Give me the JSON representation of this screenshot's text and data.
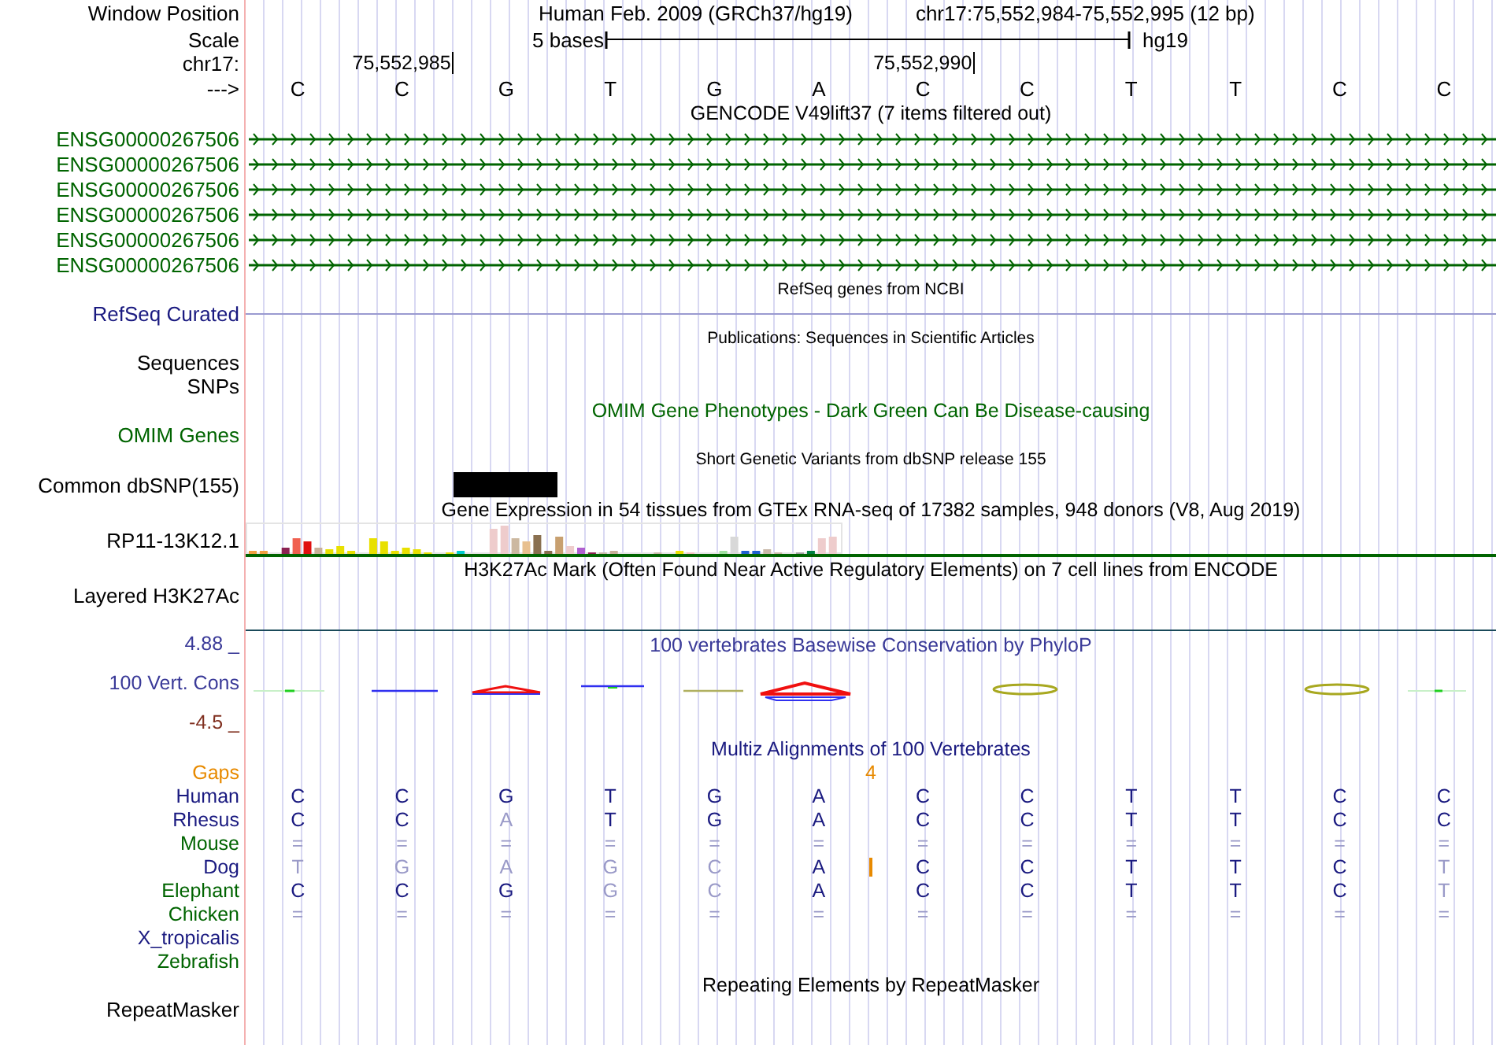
{
  "header": {
    "position_label": "Window Position",
    "assembly": "Human Feb. 2009 (GRCh37/hg19)",
    "position": "chr17:75,552,984-75,552,995 (12 bp)",
    "scale_label": "Scale",
    "scale_text": "5 bases",
    "scale_db": "hg19",
    "chrom_label": "chr17:",
    "ticks": [
      "75,552,985",
      "75,552,990"
    ],
    "strand_label": "--->",
    "bases": [
      "C",
      "C",
      "G",
      "T",
      "G",
      "A",
      "C",
      "C",
      "T",
      "T",
      "C",
      "C"
    ]
  },
  "tracks": [
    {
      "kind": "title",
      "text": "GENCODE V49lift37 (7 items filtered out)",
      "color": "#000000"
    },
    {
      "kind": "gene",
      "label": "ENSG00000267506",
      "color": "#006400"
    },
    {
      "kind": "gene",
      "label": "ENSG00000267506",
      "color": "#006400"
    },
    {
      "kind": "gene",
      "label": "ENSG00000267506",
      "color": "#006400"
    },
    {
      "kind": "gene",
      "label": "ENSG00000267506",
      "color": "#006400"
    },
    {
      "kind": "gene",
      "label": "ENSG00000267506",
      "color": "#006400"
    },
    {
      "kind": "gene",
      "label": "ENSG00000267506",
      "color": "#006400"
    },
    {
      "kind": "note",
      "text": "RefSeq genes from NCBI",
      "color": "#000000"
    },
    {
      "kind": "line",
      "label": "RefSeq Curated",
      "color": "#1a1a80"
    },
    {
      "kind": "note",
      "text": "Publications: Sequences in Scientific Articles",
      "color": "#000000"
    },
    {
      "kind": "label",
      "label": "Sequences",
      "color": "#000000"
    },
    {
      "kind": "label",
      "label": "SNPs",
      "color": "#000000"
    },
    {
      "kind": "title",
      "text": "OMIM Gene Phenotypes - Dark Green Can Be Disease-causing",
      "color": "#006400"
    },
    {
      "kind": "label",
      "label": "OMIM Genes",
      "color": "#006400"
    },
    {
      "kind": "note",
      "text": "Short Genetic Variants from dbSNP release 155",
      "color": "#000000"
    },
    {
      "kind": "snp",
      "label": "Common dbSNP(155)",
      "color": "#000000"
    },
    {
      "kind": "title",
      "text": "Gene Expression in 54 tissues from GTEx RNA-seq of 17382 samples, 948 donors (V8, Aug 2019)",
      "color": "#000000"
    },
    {
      "kind": "expression",
      "label": "RP11-13K12.1",
      "color": "#000000"
    },
    {
      "kind": "title",
      "text": "H3K27Ac Mark (Often Found Near Active Regulatory Elements) on 7 cell lines from ENCODE",
      "color": "#000000"
    },
    {
      "kind": "signal",
      "label": "Layered H3K27Ac",
      "color": "#000000"
    },
    {
      "kind": "conservation",
      "title": "100 vertebrates Basewise Conservation by PhyloP",
      "label": "100 Vert. Cons",
      "max": "4.88 _",
      "min": "-4.5 _"
    },
    {
      "kind": "title",
      "text": "Multiz Alignments of 100 Vertebrates",
      "color": "#1a1a80"
    },
    {
      "kind": "gaps",
      "label": "Gaps",
      "count": "4"
    },
    {
      "kind": "species",
      "label": "Human",
      "color": "#1a1a80",
      "insertion": false,
      "bases": [
        "C",
        "C",
        "G",
        "T",
        "G",
        "A",
        "C",
        "C",
        "T",
        "T",
        "C",
        "C"
      ]
    },
    {
      "kind": "species",
      "label": "Rhesus",
      "color": "#1a1a80",
      "insertion": false,
      "bases": [
        "C",
        "C",
        "A",
        "T",
        "G",
        "A",
        "C",
        "C",
        "T",
        "T",
        "C",
        "C"
      ]
    },
    {
      "kind": "species",
      "label": "Mouse",
      "color": "#006400",
      "insertion": false,
      "bases": [
        "=",
        "=",
        "=",
        "=",
        "=",
        "=",
        "=",
        "=",
        "=",
        "=",
        "=",
        "="
      ]
    },
    {
      "kind": "species",
      "label": "Dog",
      "color": "#1a1a80",
      "insertion": true,
      "bases": [
        "T",
        "G",
        "A",
        "G",
        "C",
        "A",
        "C",
        "C",
        "T",
        "T",
        "C",
        "T"
      ]
    },
    {
      "kind": "species",
      "label": "Elephant",
      "color": "#006400",
      "insertion": false,
      "bases": [
        "C",
        "C",
        "G",
        "G",
        "C",
        "A",
        "C",
        "C",
        "T",
        "T",
        "C",
        "T"
      ]
    },
    {
      "kind": "species",
      "label": "Chicken",
      "color": "#006400",
      "insertion": false,
      "bases": [
        "=",
        "=",
        "=",
        "=",
        "=",
        "=",
        "=",
        "=",
        "=",
        "=",
        "=",
        "="
      ]
    },
    {
      "kind": "species",
      "label": "X_tropicalis",
      "color": "#1a1a80",
      "insertion": false
    },
    {
      "kind": "species",
      "label": "Zebrafish",
      "color": "#006400",
      "insertion": false
    },
    {
      "kind": "title",
      "text": "Repeating Elements by RepeatMasker",
      "color": "#000000"
    },
    {
      "kind": "label",
      "label": "RepeatMasker",
      "color": "#000000"
    }
  ]
}
